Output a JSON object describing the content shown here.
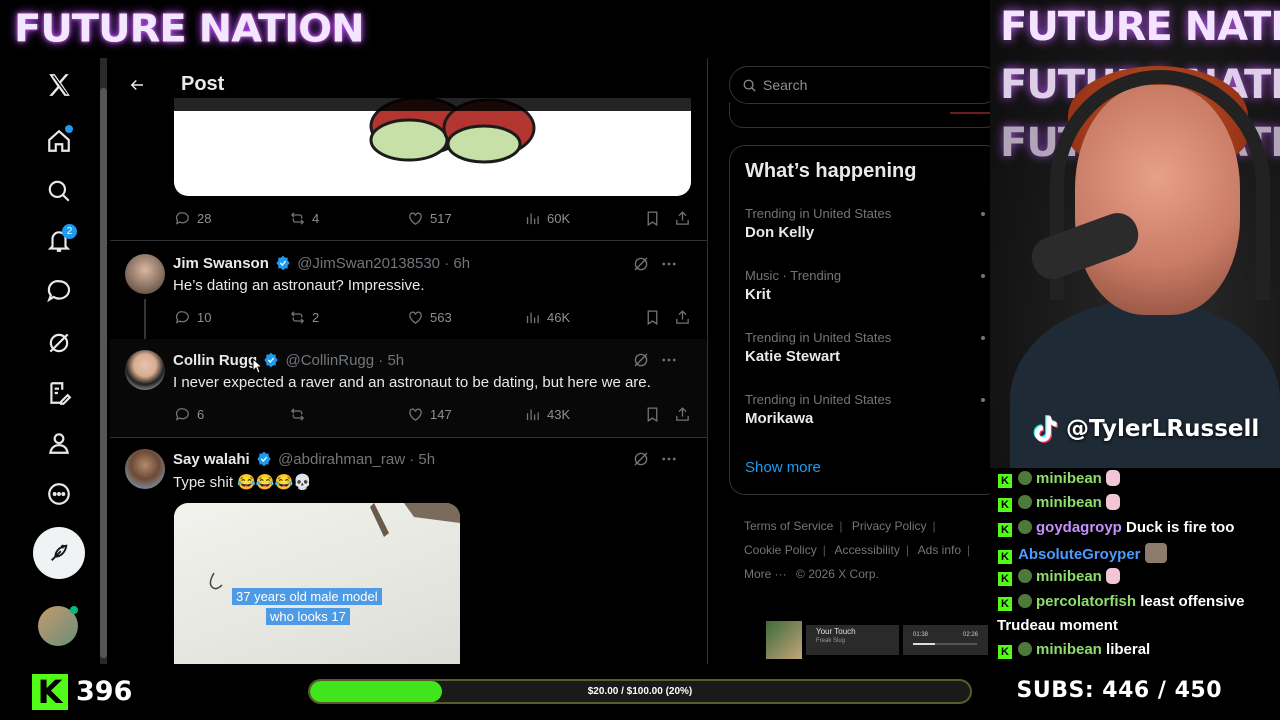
{
  "stream": {
    "brand": "FUTURE NATION",
    "tiktok_handle": "@TylerLRussell",
    "kick_followers": "396",
    "goal_text": "$20.00 / $100.00 (20%)",
    "goal_percent": 20,
    "subs_label": "SUBS:",
    "subs_value": "446 / 450"
  },
  "nav": {
    "items": [
      "x-logo",
      "home",
      "explore",
      "notifications",
      "messages",
      "grok",
      "lists",
      "profile",
      "more",
      "post"
    ],
    "notification_count": "2"
  },
  "header": {
    "title": "Post"
  },
  "top_post_actions": {
    "replies": "28",
    "reposts": "4",
    "likes": "517",
    "views": "60K"
  },
  "replies": [
    {
      "name": "Jim Swanson",
      "handle": "@JimSwan20138530",
      "time": "· 6h",
      "text": "He’s dating an astronaut? Impressive.",
      "replies": "10",
      "reposts": "2",
      "likes": "563",
      "views": "46K"
    },
    {
      "name": "Collin Rugg",
      "handle": "@CollinRugg",
      "time": "· 5h",
      "text": "I never expected a raver and an astronaut to be dating, but here we are.",
      "replies": "6",
      "reposts": "",
      "likes": "147",
      "views": "43K"
    },
    {
      "name": "Say walahi",
      "handle": "@abdirahman_raw",
      "time": "· 5h",
      "text": "Type shit 😂😂😂💀",
      "media_caption_1": "37 years old male model",
      "media_caption_2": "who looks 17"
    }
  ],
  "sidebar": {
    "search_placeholder": "Search",
    "whats_happening": "What’s happening",
    "trends": [
      {
        "context": "Trending in United States",
        "name": "Don Kelly"
      },
      {
        "context": "Music · Trending",
        "name": "Krit"
      },
      {
        "context": "Trending in United States",
        "name": "Katie Stewart"
      },
      {
        "context": "Trending in United States",
        "name": "Morikawa"
      }
    ],
    "show_more": "Show more",
    "footer": {
      "terms": "Terms of Service",
      "privacy": "Privacy Policy",
      "cookie": "Cookie Policy",
      "accessibility": "Accessibility",
      "ads": "Ads info",
      "more": "More ···",
      "copyright": "© 2026 X Corp."
    }
  },
  "player": {
    "title": "Your Touch",
    "artist": "Freak Slug",
    "elapsed": "01:38",
    "duration": "02:26",
    "progress": 0.35
  },
  "chat": [
    {
      "user": "minibean",
      "text": "",
      "color": "#8dde6b"
    },
    {
      "user": "minibean",
      "text": "",
      "color": "#8dde6b"
    },
    {
      "user": "goydagroyp",
      "text": "Duck is fire too",
      "color": "#c590ff"
    },
    {
      "user": "AbsoluteGroyper",
      "text": "",
      "color": "#4d9aff"
    },
    {
      "user": "minibean",
      "text": "",
      "color": "#8dde6b"
    },
    {
      "user": "percolatorfish",
      "text": "least offensive",
      "continuation": "Trudeau moment",
      "color": "#8dde6b"
    },
    {
      "user": "minibean",
      "text": "liberal",
      "color": "#8dde6b"
    }
  ],
  "colors": {
    "x_blue": "#1d9bf0",
    "kick_green": "#53fc18",
    "goal_green": "#41e51e"
  }
}
